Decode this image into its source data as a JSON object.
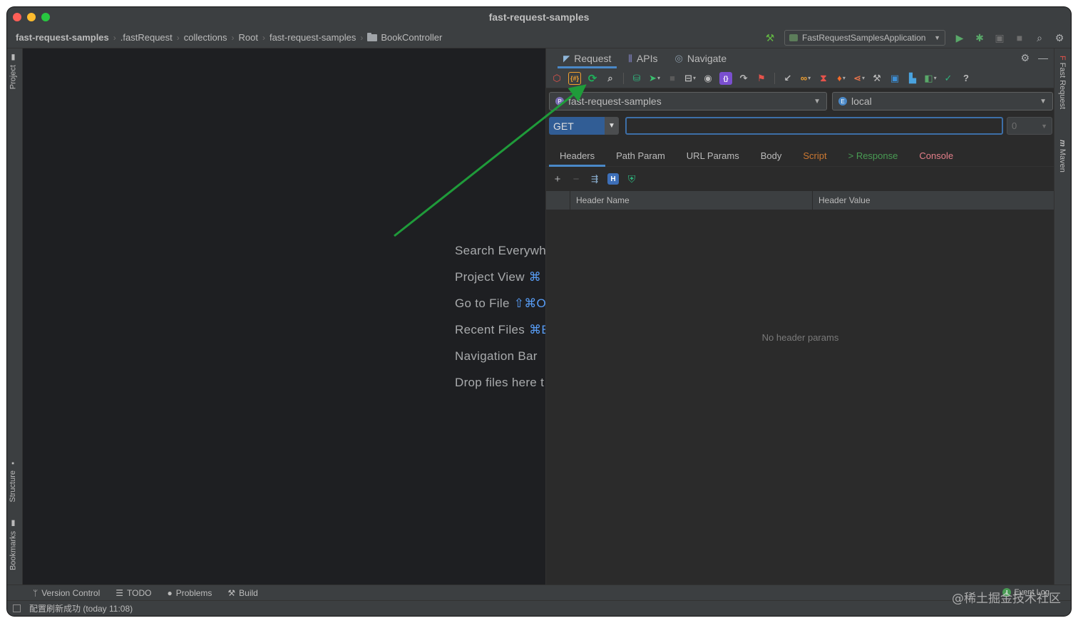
{
  "window": {
    "title": "fast-request-samples"
  },
  "breadcrumb": [
    "fast-request-samples",
    ".fastRequest",
    "collections",
    "Root",
    "fast-request-samples",
    "BookController"
  ],
  "run_config": {
    "label": "FastRequestSamplesApplication"
  },
  "left_strip": {
    "project": "Project",
    "structure": "Structure",
    "bookmarks": "Bookmarks"
  },
  "right_strip": {
    "fast_request": "Fast Request",
    "maven": "Maven"
  },
  "editor_hints": [
    {
      "text": "Search Everywh",
      "key": ""
    },
    {
      "text": "Project View",
      "key": "⌘"
    },
    {
      "text": "Go to File",
      "key": "⇧⌘O"
    },
    {
      "text": "Recent Files",
      "key": "⌘E"
    },
    {
      "text": "Navigation Bar",
      "key": ""
    },
    {
      "text": "Drop files here t",
      "key": ""
    }
  ],
  "panel": {
    "tabs": [
      "Request",
      "APIs",
      "Navigate"
    ],
    "project_select": "fast-request-samples",
    "env_select": "local",
    "method": "GET",
    "url_value": "",
    "timeout": "0",
    "sub_tabs": [
      {
        "label": "Headers",
        "color": "#bbbbbb"
      },
      {
        "label": "Path Param",
        "color": "#bbbbbb"
      },
      {
        "label": "URL Params",
        "color": "#bbbbbb"
      },
      {
        "label": "Body",
        "color": "#bbbbbb"
      },
      {
        "label": "Script",
        "color": "#cc7832"
      },
      {
        "label": "> Response",
        "color": "#499c54"
      },
      {
        "label": "Console",
        "color": "#e57f8a"
      }
    ],
    "table_headers": [
      "Header Name",
      "Header Value"
    ],
    "empty_message": "No header params"
  },
  "bottom_tabs": [
    "Version Control",
    "TODO",
    "Problems",
    "Build"
  ],
  "status": {
    "message": "配置刷新成功 (today 11:08)",
    "event_log": "Event Log",
    "event_count": "1"
  },
  "watermark": "@稀土掘金技术社区",
  "colors": {
    "accent": "#4a88c7",
    "arrow": "#1f9b3a"
  }
}
